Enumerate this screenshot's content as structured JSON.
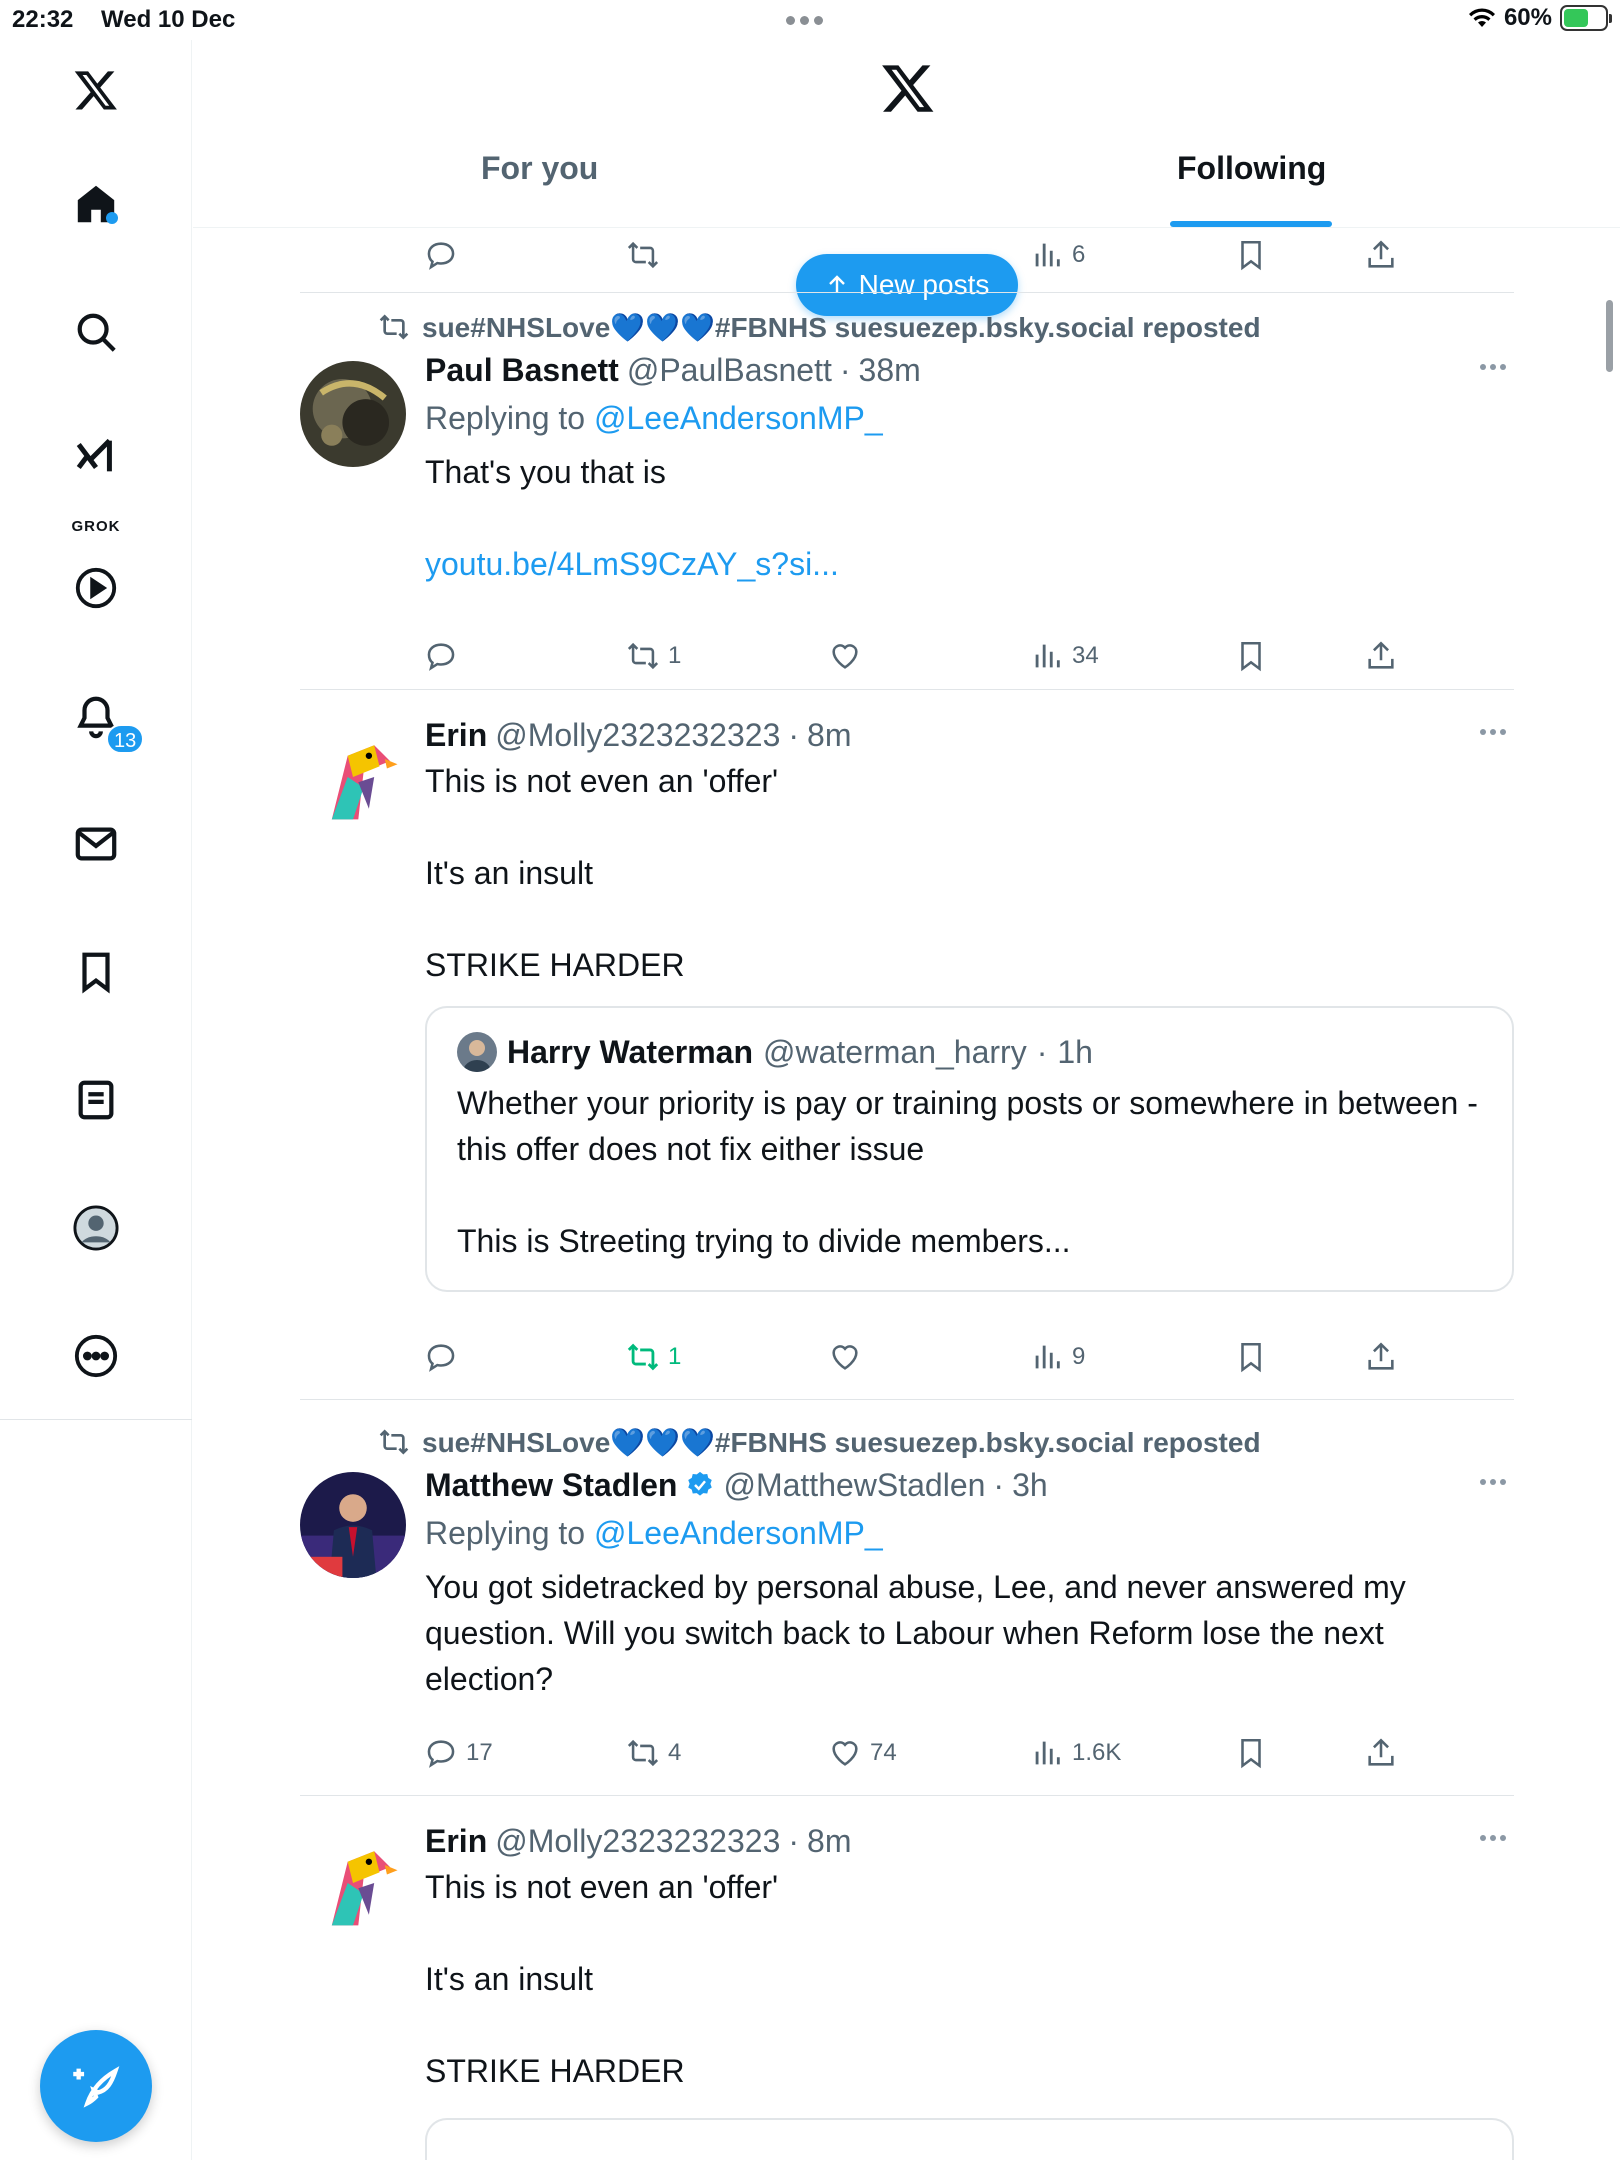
{
  "status_bar": {
    "time": "22:32",
    "date": "Wed 10 Dec",
    "battery": "60%",
    "battery_level": 0.6
  },
  "sidebar": {
    "notifications_count": "13",
    "grok_label": "GROK",
    "items": [
      "home-icon",
      "search-icon",
      "grok-icon",
      "play-icon",
      "bell-icon",
      "mail-icon",
      "bookmark-icon",
      "list-icon",
      "profile-icon",
      "more-icon"
    ]
  },
  "header": {
    "tabs": [
      {
        "label": "For you"
      },
      {
        "label": "Following"
      }
    ]
  },
  "top_actions": {
    "views": "6"
  },
  "new_posts": {
    "label": "New posts"
  },
  "posts": [
    {
      "repost_by": "sue#NHSLove💙💙💙#FBNHS suesuezep.bsky.social reposted",
      "name": "Paul Basnett",
      "handle": "@PaulBasnett",
      "dot": "·",
      "time": "38m",
      "replying_prefix": "Replying to ",
      "replying_to": "@LeeAndersonMP_",
      "text": "That's you that is",
      "link": "youtu.be/4LmS9CzAY_s?si...",
      "replies": "",
      "reposts": "1",
      "likes": "",
      "views": "34"
    },
    {
      "name": "Erin",
      "handle": "@Molly2323232323",
      "dot": "·",
      "time": "8m",
      "text": "This is not even an 'offer'\n\nIt's an insult\n\nSTRIKE HARDER",
      "quote": {
        "name": "Harry Waterman",
        "handle": "@waterman_harry",
        "dot": "·",
        "time": "1h",
        "text": "Whether your priority is pay or training posts or somewhere in between - this offer does not fix either issue\n\nThis is Streeting trying to divide members..."
      },
      "replies": "",
      "reposts": "1",
      "likes": "",
      "views": "9"
    },
    {
      "repost_by": "sue#NHSLove💙💙💙#FBNHS suesuezep.bsky.social reposted",
      "name": "Matthew Stadlen",
      "handle": "@MatthewStadlen",
      "dot": "·",
      "time": "3h",
      "replying_prefix": "Replying to ",
      "replying_to": "@LeeAndersonMP_",
      "text": "You got sidetracked by personal abuse, Lee, and never answered my question. Will you switch back to Labour when Reform lose the next election?",
      "replies": "17",
      "reposts": "4",
      "likes": "74",
      "views": "1.6K"
    },
    {
      "name": "Erin",
      "handle": "@Molly2323232323",
      "dot": "·",
      "time": "8m",
      "text": "This is not even an 'offer'\n\nIt's an insult\n\nSTRIKE HARDER"
    }
  ],
  "colors": {
    "accent": "#1d9bf0",
    "retweet_active": "#00ba7c",
    "muted": "#536471",
    "text": "#0f1419"
  }
}
